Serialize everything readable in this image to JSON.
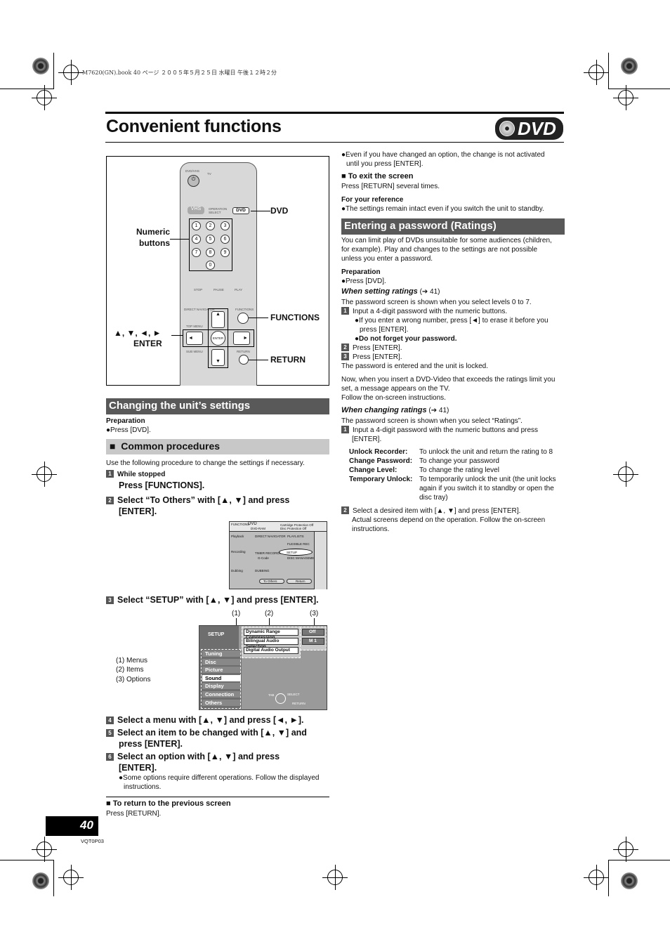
{
  "print_info": "M7620(GN).book  40 ページ  ２００５年５月２５日  水曜日  午後１２時２分",
  "title": "Convenient functions",
  "badge": "DVD",
  "remote": {
    "labels": {
      "dvd": "DVD",
      "numeric": "Numeric buttons",
      "functions": "FUNCTIONS",
      "arrows": "▲, ▼, ◄, ►",
      "enter": "ENTER",
      "return": "RETURN"
    },
    "keys": [
      "1",
      "2",
      "3",
      "4",
      "5",
      "6",
      "7",
      "8",
      "9",
      "0"
    ],
    "small": {
      "dvdvhs": "DVD/VHS",
      "tv": "TV",
      "vhs": "VHS",
      "opsel": "OPERATION SELECT",
      "dvdkey": "DVD",
      "enterkey": "ENTER",
      "functions": "FUNCTIONS",
      "return": "RETURN",
      "stop": "STOP",
      "pause": "PAUSE",
      "play": "PLAY",
      "direct": "DIRECT NAVIGATOR",
      "topmenu": "TOP MENU",
      "submenu": "SUB MENU"
    }
  },
  "left": {
    "section": "Changing the unit’s settings",
    "prep_head": "Preparation",
    "prep_item": "●Press [DVD].",
    "sub": "Common procedures",
    "intro": "Use the following procedure to change the settings if necessary.",
    "steps": [
      {
        "n": "1",
        "pre": "While stopped",
        "text": "Press [FUNCTIONS]."
      },
      {
        "n": "2",
        "text": "Select “To Others” with [▲, ▼] and press",
        "text2": "[ENTER]."
      },
      {
        "n": "3",
        "text": "Select “SETUP” with [▲, ▼] and press [ENTER]."
      },
      {
        "n": "4",
        "text": "Select a menu with [▲, ▼] and press [◄, ►]."
      },
      {
        "n": "5",
        "text": "Select an item to be changed with [▲, ▼] and",
        "text2": "press [ENTER]."
      },
      {
        "n": "6",
        "text": "Select an option with [▲, ▼] and press",
        "text2": "[ENTER].",
        "note1": "●Some options require different operations. Follow the displayed",
        "note2": "instructions."
      }
    ],
    "func_screen": {
      "header": "FUNCTIONS",
      "disc": "DVD",
      "disc2": "DVD-RAM",
      "prot1": "Cartridge Protection Off",
      "prot2": "Disc Protection Off",
      "rows": [
        "Playback",
        "Recording",
        "Dubbing"
      ],
      "items": [
        "DIRECT NAVIGATOR",
        "PLAYLISTS",
        "FLEXIBLE REC",
        "TIMER RECORDING",
        "SETUP",
        "G-Code",
        "DISC MANAGEMENT",
        "DUBBING"
      ],
      "buttons": [
        "To Others",
        "Return"
      ]
    },
    "setup_screen": {
      "callouts": [
        "(1)",
        "(2)",
        "(3)"
      ],
      "title": "SETUP",
      "menus": [
        "Tuning",
        "Disc",
        "Picture",
        "Sound",
        "Display",
        "Connection",
        "Others"
      ],
      "selected_menu": "Sound",
      "items": [
        "Dynamic Range Compression",
        "Bilingual Audio Selection",
        "Digital Audio Output"
      ],
      "options": [
        "Off",
        "M 1"
      ],
      "nav": {
        "tab": "TAB",
        "select": "SELECT",
        "return": "RETURN"
      }
    },
    "legend": [
      "(1)  Menus",
      "(2)  Items",
      "(3)  Options"
    ],
    "return_head": "■ To return to the previous screen",
    "return_text": "Press [RETURN]."
  },
  "right": {
    "note1": "●Even if you have changed an option, the change is not activated",
    "note1b": "until you press [ENTER].",
    "exit_head": "■ To exit the screen",
    "exit_text": "Press [RETURN] several times.",
    "ref_head": "For your reference",
    "ref_text": "●The settings remain intact even if you switch the unit to standby.",
    "section": "Entering a password (Ratings)",
    "intro": [
      "You can limit play of DVDs unsuitable for some audiences (children,",
      "for example). Play and changes to the settings are not possible",
      "unless you enter a password."
    ],
    "prep_head": "Preparation",
    "prep_item": "●Press [DVD].",
    "setting_head": "When setting ratings",
    "setting_ref": "(➔ 41)",
    "setting_text": "The password screen is shown when you select levels 0 to 7.",
    "s1": "Input a 4-digit password with the numeric buttons.",
    "s1a": "●If you enter a wrong number, press [◄] to erase it before you",
    "s1a2": "press [ENTER].",
    "s1b": "●Do not forget your password.",
    "s2": "Press [ENTER].",
    "s3": "Press [ENTER].",
    "locked": "The password is entered and the unit is locked.",
    "now": [
      "Now, when you insert a DVD-Video that exceeds the ratings limit you",
      "set, a message appears on the TV.",
      "Follow the on-screen instructions."
    ],
    "changing_head": "When changing ratings",
    "changing_ref": "(➔ 41)",
    "changing_text": "The password screen is shown when you select “Ratings”.",
    "c1": "Input a 4-digit password with the numeric buttons and press",
    "c1b": "[ENTER].",
    "defs": [
      {
        "term": "Unlock Recorder:",
        "desc": "To unlock the unit and return the rating to 8"
      },
      {
        "term": "Change Password:",
        "desc": "To change your password"
      },
      {
        "term": "Change Level:",
        "desc": "To change the rating level"
      },
      {
        "term": "Temporary Unlock:",
        "desc": "To temporarily unlock the unit (the unit locks",
        "desc2": "again if you switch it to standby or open the",
        "desc3": "disc tray)"
      }
    ],
    "c2": "Select a desired item with [▲, ▼] and press [ENTER].",
    "c2b": "Actual screens depend on the operation. Follow the on-screen",
    "c2c": "instructions."
  },
  "page_number": "40",
  "code": "VQT0P03"
}
